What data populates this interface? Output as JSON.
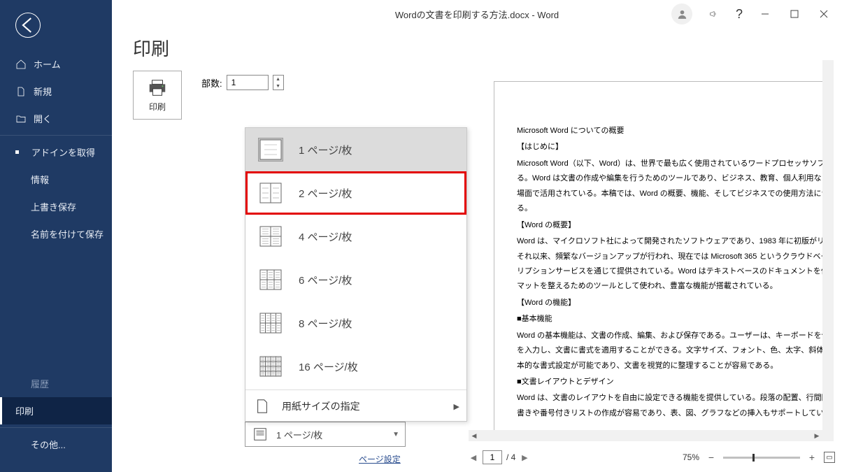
{
  "titlebar": {
    "title": "Wordの文書を印刷する方法.docx  -  Word"
  },
  "page_title": "印刷",
  "sidebar": {
    "items": [
      {
        "label": "ホーム"
      },
      {
        "label": "新規"
      },
      {
        "label": "開く"
      },
      {
        "label": "アドインを取得"
      },
      {
        "label": "情報"
      },
      {
        "label": "上書き保存"
      },
      {
        "label": "名前を付けて保存"
      },
      {
        "label": "履歴"
      },
      {
        "label": "印刷"
      },
      {
        "label": "その他..."
      }
    ]
  },
  "print": {
    "button_label": "印刷",
    "copies_label": "部数:",
    "copies_value": "1"
  },
  "pps_menu": {
    "items": [
      {
        "label": "1 ページ/枚",
        "cols": 1,
        "rows": 1
      },
      {
        "label": "2 ページ/枚",
        "cols": 2,
        "rows": 1
      },
      {
        "label": "4 ページ/枚",
        "cols": 2,
        "rows": 2
      },
      {
        "label": "6 ページ/枚",
        "cols": 3,
        "rows": 2
      },
      {
        "label": "8 ページ/枚",
        "cols": 4,
        "rows": 2
      },
      {
        "label": "16 ページ/枚",
        "cols": 4,
        "rows": 4
      }
    ],
    "footer": "用紙サイズの指定"
  },
  "selector": {
    "current": "1 ページ/枚"
  },
  "page_setup_link": "ページ設定",
  "footer": {
    "current_page": "1",
    "total_pages": "/ 4",
    "zoom": "75%"
  },
  "doc": {
    "lines": [
      "Microsoft Word についての概要",
      "【はじめに】",
      "Microsoft Word（以下、Word）は、世界で最も広く使用されているワードプロセッサソフトウェアである。Word は文書の作成や編集を行うためのツールであり、ビジネス、教育、個人利用など、さまざまな場面で活用されている。本稿では、Word の概要、機能、そしてビジネスでの使用方法について説明する。",
      "【Word の概要】",
      "Word は、マイクロソフト社によって開発されたソフトウェアであり、1983 年に初版がリリースされた。それ以来、頻繁なバージョンアップが行われ、現在では Microsoft 365 というクラウドベースのサブスクリプションサービスを通じて提供されている。Word はテキストベースのドキュメントを作成し、フォーマットを整えるためのツールとして使われ、豊富な機能が搭載されている。",
      "【Word の機能】",
      "■基本機能",
      "Word の基本機能は、文書の作成、編集、および保存である。ユーザーは、キーボードを使ってテキストを入力し、文書に書式を適用することができる。文字サイズ、フォント、色、太字、斜体、下線などの基本的な書式設定が可能であり、文書を視覚的に整理することが容易である。",
      "■文書レイアウトとデザイン",
      "Word は、文書のレイアウトを自由に設定できる機能を提供している。段落の配置、行間隔の調整、箇条書きや番号付きリストの作成が容易であり、表、図、グラフなどの挿入もサポートしている。また、標準"
    ]
  }
}
